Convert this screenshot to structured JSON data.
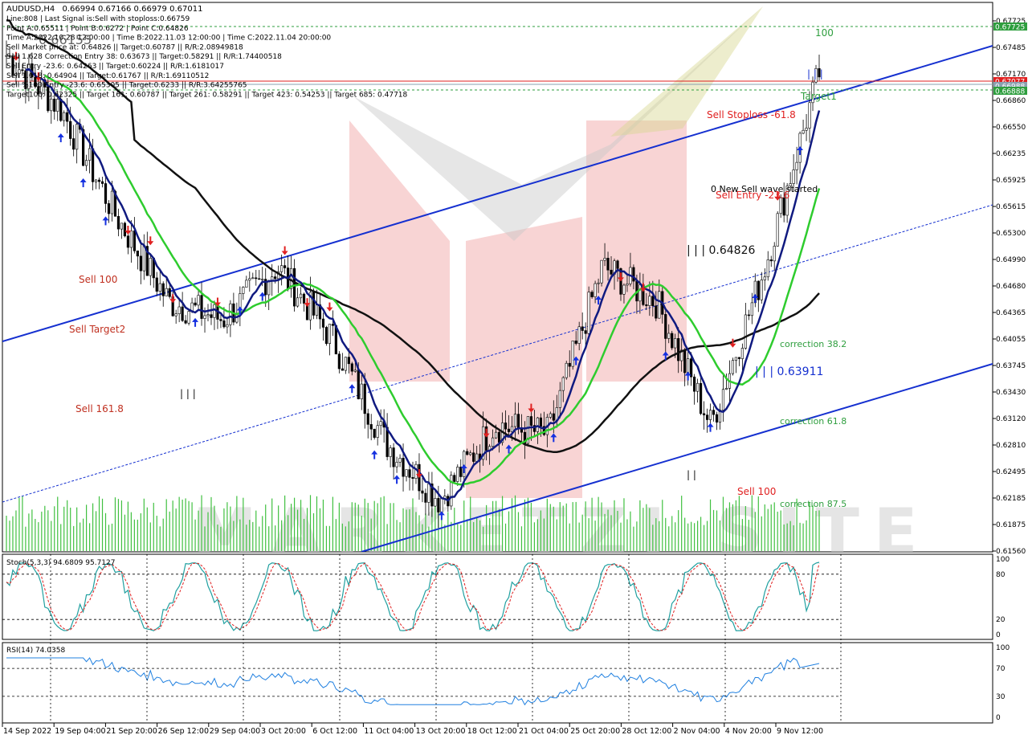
{
  "header": {
    "symbol": "AUDUSD,H4",
    "ohlc": "0.66994 0.67166 0.66979 0.67011",
    "info_lines": [
      "Line:808 | Last Signal is:Sell with stoploss:0.66759",
      "Point A:0.65511 | Point B:0.6272 | Point C:0.64826",
      "Time A:2022.10.28 12:00:00 | Time B:2022.11.03 12:00:00 | Time C:2022.11.04 20:00:00",
      "Sell Market price at: 0.64826 || Target:0.60787 || R/R:2.08949818",
      "Sell 1.628 Correction Entry 38: 0.63673 || Target:0.58291 || R/R:1.74400518",
      "Sell Entry -23.6: 0.64263 || Target:0.60224 || R/R:1.6181017",
      "Sell 1.618: 0.64904 || Target:0.61767 || R/R:1.69110512",
      "Sell %100 Entry -23.6: 0.65305 || Target:0.6233 || R/R:3.64255765",
      "Target100: 0.62325 || Target 161: 0.60787 || Target 261: 0.58291 || Target 423: 0.54253 || Target 685: 0.47718"
    ],
    "overlay_price": "0.66155"
  },
  "price_axis": {
    "ticks": [
      "0.67725",
      "0.67485",
      "0.67170",
      "0.66860",
      "0.66550",
      "0.66235",
      "0.65925",
      "0.65615",
      "0.65300",
      "0.64990",
      "0.64680",
      "0.64365",
      "0.64055",
      "0.63745",
      "0.63430",
      "0.63120",
      "0.62810",
      "0.62495",
      "0.62185",
      "0.61875",
      "0.61560"
    ],
    "highlights": [
      {
        "label": "0.67725",
        "color": "#2e9e3e"
      },
      {
        "label": "0.67077",
        "color": "#e02020"
      },
      {
        "label": "0.66988",
        "color": "#8aa0b0"
      },
      {
        "label": "0.66888",
        "color": "#2e9e3e"
      }
    ]
  },
  "time_axis": {
    "labels": [
      "14 Sep 2022",
      "19 Sep 04:00",
      "21 Sep 20:00",
      "26 Sep 12:00",
      "29 Sep 04:00",
      "3 Oct 20:00",
      "6 Oct 12:00",
      "11 Oct 04:00",
      "13 Oct 20:00",
      "18 Oct 12:00",
      "21 Oct 04:00",
      "25 Oct 20:00",
      "28 Oct 12:00",
      "2 Nov 04:00",
      "4 Nov 20:00",
      "9 Nov 12:00"
    ]
  },
  "annotations": {
    "level_100_top": "100",
    "target1": "Target1",
    "sell_stoploss": "Sell Stoploss -61.8",
    "new_sell_wave": "0 New Sell wave started",
    "sell_entry": "Sell Entry -23.6",
    "price_c": "| | | 0.64826",
    "price_low": "| | | 0.63911",
    "sell_100_left": "Sell 100",
    "sell_target2": "Sell Target2",
    "sell_161": "Sell 161.8",
    "correction_382": "correction 38.2",
    "correction_618": "correction 61.8",
    "correction_875": "correction 87.5",
    "sell_100_bottom": "Sell 100",
    "tick_marks_a": "| | |",
    "tick_marks_b": "| |",
    "tick_marks_c": "| | |"
  },
  "stoch": {
    "label": "Stoch(5,3,3) 94.6809 95.7127",
    "levels": [
      "100",
      "80",
      "20",
      "0"
    ]
  },
  "rsi": {
    "label": "RSI(14) 74.0358",
    "levels": [
      "100",
      "70",
      "30",
      "0"
    ]
  },
  "colors": {
    "ma_fast": "#101a80",
    "ma_mid": "#2ecc2e",
    "ma_slow": "#111111",
    "channel": "#1530d0",
    "sell": "#e02020",
    "buy": "#1530e0",
    "volume": "#40c040",
    "stoch_main": "#20a0a0",
    "stoch_signal": "#e02020",
    "rsi": "#2080e0"
  },
  "chart_data": {
    "type": "line",
    "title": "AUDUSD,H4",
    "x": [
      "14 Sep 2022",
      "19 Sep 04:00",
      "21 Sep 20:00",
      "26 Sep 12:00",
      "29 Sep 04:00",
      "3 Oct 20:00",
      "6 Oct 12:00",
      "11 Oct 04:00",
      "13 Oct 20:00",
      "18 Oct 12:00",
      "21 Oct 04:00",
      "25 Oct 20:00",
      "28 Oct 12:00",
      "2 Nov 04:00",
      "4 Nov 20:00",
      "9 Nov 12:00"
    ],
    "series": [
      {
        "name": "",
        "values": [
          0.672,
          0.666,
          0.654,
          0.644,
          0.642,
          0.648,
          0.64,
          0.628,
          0.6215,
          0.63,
          0.629,
          0.648,
          0.644,
          0.63,
          0.648,
          0.67
        ]
      }
    ],
    "ylim": [
      0.6156,
      0.678
    ],
    "grid": true,
    "legend": "none"
  }
}
